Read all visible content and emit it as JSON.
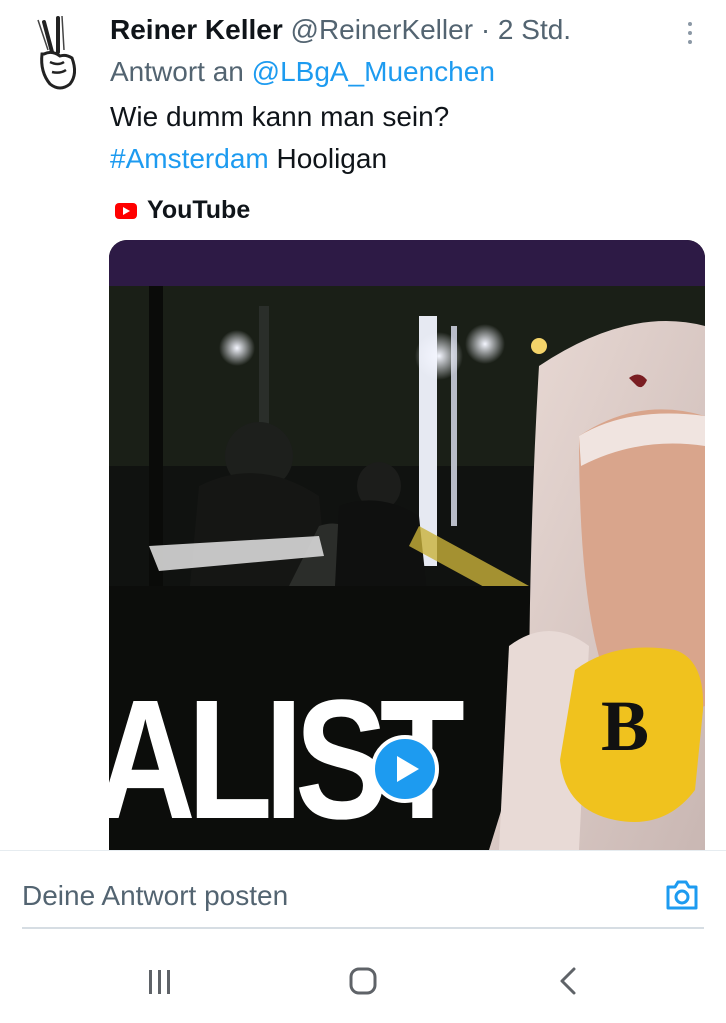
{
  "tweet": {
    "author_name": "Reiner Keller",
    "author_handle": "@ReinerKeller",
    "separator": "·",
    "time": "2 Std.",
    "reply_prefix": "Antwort an",
    "reply_to": "@LBgA_Muenchen",
    "text_line1": "Wie dumm kann man sein?",
    "hashtag": "#Amsterdam",
    "text_rest": "Hooligan",
    "avatar_icon": "peace-hand-icon",
    "more_icon": "more-vertical-icon"
  },
  "card": {
    "source_label": "YouTube",
    "source_icon": "youtube-icon",
    "overlay_text": "ALIST",
    "play_icon": "play-icon",
    "mic_letter": "B"
  },
  "reply": {
    "placeholder": "Deine Antwort posten",
    "camera_icon": "camera-icon"
  },
  "system_nav": {
    "recents_icon": "recent-apps-icon",
    "home_icon": "home-icon",
    "back_icon": "back-icon"
  },
  "colors": {
    "link": "#1d9bf0",
    "secondary_text": "#536471",
    "card_header": "#2d1a45",
    "youtube_red": "#ff0000"
  }
}
